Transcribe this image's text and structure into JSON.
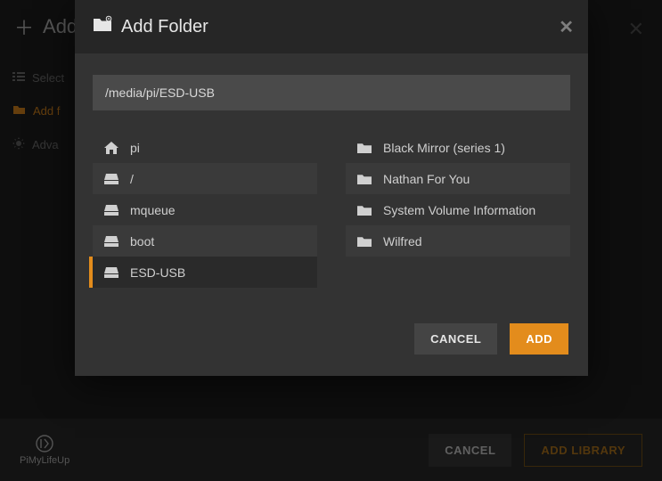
{
  "background": {
    "header_title": "Add",
    "close_glyph": "✕",
    "steps": {
      "select": "Select",
      "add_folders": "Add f",
      "advanced": "Adva"
    },
    "footer": {
      "brand": "PiMyLifeUp",
      "cancel": "CANCEL",
      "add_library": "ADD LIBRARY"
    }
  },
  "modal": {
    "title": "Add Folder",
    "path_value": "/media/pi/ESD-USB",
    "close_glyph": "✕",
    "actions": {
      "cancel": "CANCEL",
      "add": "ADD"
    },
    "left_items": [
      {
        "icon": "home",
        "label": "pi",
        "selected": false,
        "alt": false
      },
      {
        "icon": "drive",
        "label": "/",
        "selected": false,
        "alt": true
      },
      {
        "icon": "drive",
        "label": "mqueue",
        "selected": false,
        "alt": false
      },
      {
        "icon": "drive",
        "label": "boot",
        "selected": false,
        "alt": true
      },
      {
        "icon": "drive",
        "label": "ESD-USB",
        "selected": true,
        "alt": true
      }
    ],
    "right_items": [
      {
        "icon": "folder",
        "label": "Black Mirror (series 1)",
        "selected": false,
        "alt": false
      },
      {
        "icon": "folder",
        "label": "Nathan For You",
        "selected": false,
        "alt": true
      },
      {
        "icon": "folder",
        "label": "System Volume Information",
        "selected": false,
        "alt": false
      },
      {
        "icon": "folder",
        "label": "Wilfred",
        "selected": false,
        "alt": true
      }
    ]
  }
}
